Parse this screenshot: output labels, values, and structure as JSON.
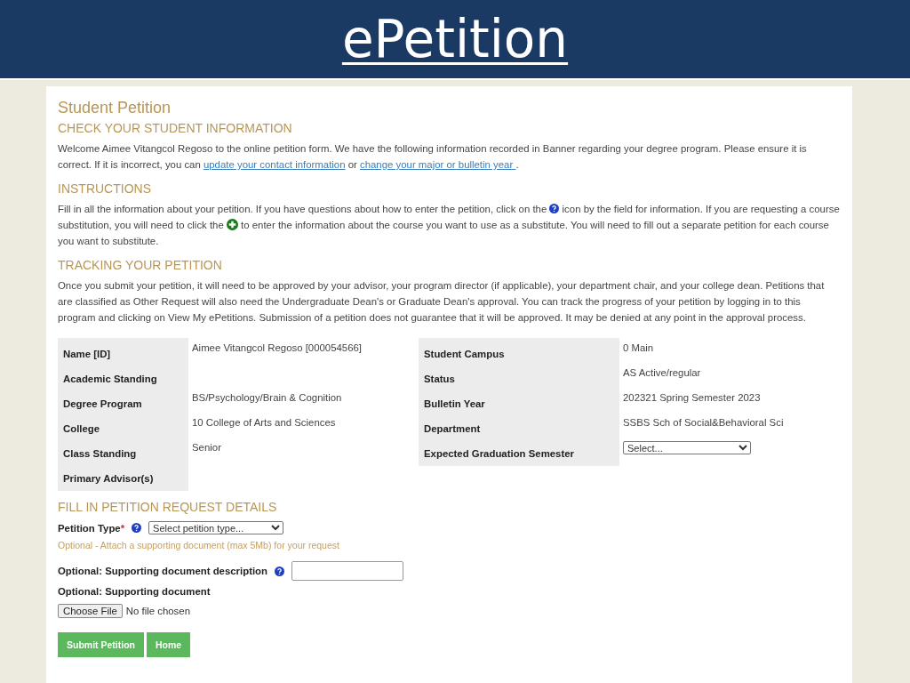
{
  "header": {
    "title": "ePetition"
  },
  "page_title": "Student Petition",
  "check_info": {
    "heading": "CHECK YOUR STUDENT INFORMATION",
    "text": "Welcome Aimee Vitangcol Regoso to the online petition form. We have the following information recorded in Banner regarding your degree program. Please ensure it is correct. If it is incorrect, you can ",
    "link_1": "update your contact information",
    "between": " or ",
    "link_2": "change your major or bulletin year ",
    "end": "."
  },
  "instructions": {
    "heading": "INSTRUCTIONS",
    "text_1": "Fill in all the information about your petition. If you have questions about how to enter the petition, click on the ",
    "text_2": " icon by the field for information. If you are requesting a course substitution, you will need to click the ",
    "text_3": " to enter the information about the course you want to use as a substitute. You will need to fill out a separate petition for each course you want to substitute."
  },
  "tracking": {
    "heading": "TRACKING YOUR PETITION",
    "text": "Once you submit your petition, it will need to be approved by your advisor, your program director (if applicable), your department chair, and your college dean. Petitions that are classified as Other Request will also need the Undergraduate Dean's or Graduate Dean's approval. You can track the progress of your petition by logging in to this program and clicking on View My ePetitions. Submission of a petition does not guarantee that it will be approved. It may be denied at any point in the approval process."
  },
  "student_info_left": [
    {
      "label": "Name [ID]",
      "value": "Aimee Vitangcol Regoso [000054566]"
    },
    {
      "label": "Academic Standing"
    },
    {
      "label": "Degree Program",
      "value": "BS/Psychology/Brain & Cognition"
    },
    {
      "label": "College",
      "value": "10 College of Arts and Sciences"
    },
    {
      "label": "Class Standing",
      "value": "Senior"
    },
    {
      "label": "Primary Advisor(s)"
    }
  ],
  "student_info_right": [
    {
      "label": "Student Campus",
      "kind": "text",
      "value": "0 Main"
    },
    {
      "label": "Status",
      "kind": "text",
      "value": "AS Active/regular"
    },
    {
      "label": "Bulletin Year",
      "kind": "text",
      "value": "202321 Spring Semester 2023"
    },
    {
      "label": "Department",
      "kind": "text",
      "value": "SSBS Sch of Social&Behavioral Sci"
    },
    {
      "label": "Expected Graduation Semester",
      "kind": "select",
      "value": "Select..."
    }
  ],
  "request": {
    "heading": "FILL IN PETITION REQUEST DETAILS",
    "petition_type_label": "Petition Type",
    "required_mark": "*",
    "petition_type_value": "Select petition type...",
    "optional_note": "Optional - Attach a supporting document (max 5Mb) for your request",
    "description_label": "Optional: Supporting document description",
    "document_label": "Optional: Supporting document",
    "choose_file": "Choose File",
    "no_file": "No file chosen"
  },
  "buttons": [
    "Submit Petition",
    "Home"
  ]
}
